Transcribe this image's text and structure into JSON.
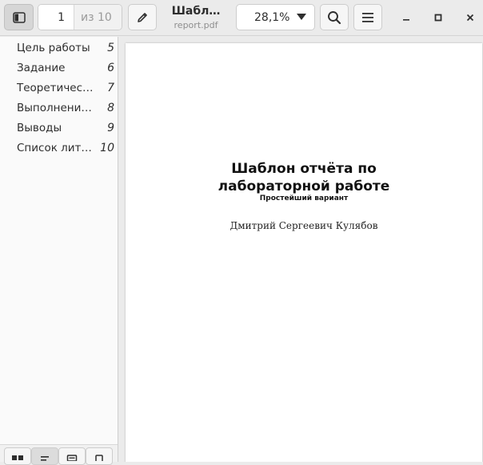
{
  "header": {
    "current_page": "1",
    "page_total": "из 10",
    "title": "Шабл…",
    "subtitle": "report.pdf",
    "zoom": "28,1%"
  },
  "sidebar": {
    "items": [
      {
        "label": "Цель работы",
        "page": "5"
      },
      {
        "label": "Задание",
        "page": "6"
      },
      {
        "label": "Теоретичес…",
        "page": "7"
      },
      {
        "label": "Выполнение…",
        "page": "8"
      },
      {
        "label": "Выводы",
        "page": "9"
      },
      {
        "label": "Список лите…",
        "page": "10"
      }
    ]
  },
  "document": {
    "title": "Шаблон отчёта по лабораторной работе",
    "subtitle": "Простейший вариант",
    "author": "Дмитрий Сергеевич Кулябов"
  },
  "icons": {
    "sidebar_toggle": "sidebar-toggle-icon",
    "edit": "pencil-icon",
    "zoom_dropdown": "triangle-down-icon",
    "search": "search-icon",
    "menu": "hamburger-menu-icon",
    "minimize": "minimize-icon",
    "maximize": "maximize-icon",
    "close": "close-icon"
  }
}
